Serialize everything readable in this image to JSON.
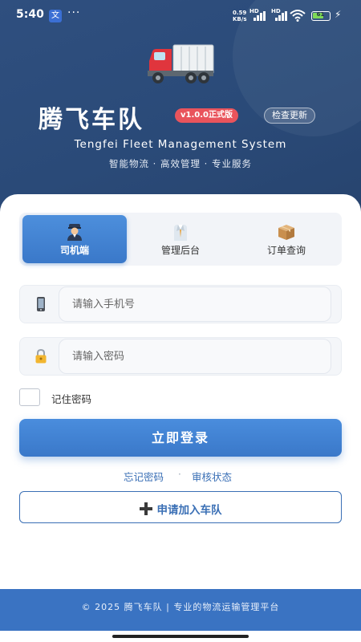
{
  "status_bar": {
    "time": "5:40",
    "app_badge": "文",
    "more": "···",
    "net_speed_value": "0.59",
    "net_speed_unit": "KB/s",
    "hd_1": "HD",
    "hd_2": "HD",
    "battery": "61"
  },
  "header": {
    "logo_icon": "truck-icon",
    "app_name": "腾飞车队",
    "version_badge": "v1.0.0正式版",
    "check_update_label": "检查更新",
    "subtitle": "Tengfei Fleet Management System",
    "slogan": "智能物流 · 高效管理 · 专业服务"
  },
  "tabs": [
    {
      "label": "司机端",
      "icon": "driver-icon",
      "active": true
    },
    {
      "label": "管理后台",
      "icon": "manager-icon",
      "active": false
    },
    {
      "label": "订单查询",
      "icon": "package-icon",
      "active": false
    }
  ],
  "form": {
    "phone_icon": "phone-icon",
    "phone_placeholder": "请输入手机号",
    "phone_value": "",
    "password_icon": "lock-icon",
    "password_placeholder": "请输入密码",
    "password_value": "",
    "remember_label": "记住密码",
    "remember_checked": false,
    "login_label": "立即登录",
    "forgot_label": "忘记密码",
    "separator": "·",
    "review_label": "审核状态",
    "join_label": "申请加入车队",
    "join_icon": "plus-icon"
  },
  "footer": {
    "text": "© 2025 腾飞车队 | 专业的物流运输管理平台"
  },
  "colors": {
    "header_bg": "#2b4a78",
    "accent": "#3a78c9",
    "link": "#3a6fb5",
    "badge_red": "#e9545c",
    "footer_bg": "#3a73c2"
  }
}
